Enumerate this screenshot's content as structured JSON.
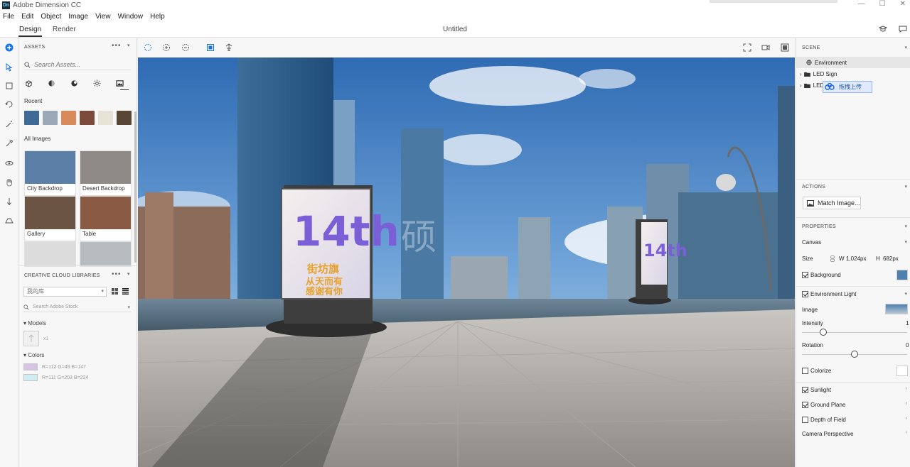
{
  "app": {
    "title": "Adobe Dimension CC",
    "icon_letters": "Dn",
    "window_controls": [
      "—",
      "☐",
      "✕"
    ]
  },
  "menu": [
    "File",
    "Edit",
    "Object",
    "Image",
    "View",
    "Window",
    "Help"
  ],
  "tabs": {
    "design": "Design",
    "render": "Render"
  },
  "document": {
    "title": "Untitled"
  },
  "assets": {
    "header": "ASSETS",
    "search_placeholder": "Search Assets...",
    "category_icons": [
      "model-icon",
      "material-icon",
      "light-icon",
      "sun-icon",
      "image-icon"
    ],
    "recent_label": "Recent",
    "recent_colors": [
      "#3e6a96",
      "#9aa8b8",
      "#d98a5a",
      "#7a4a3a",
      "#e8e3d8",
      "#5a4635"
    ],
    "all_images_label": "All Images",
    "images": [
      {
        "label": "City Backdrop",
        "color": "#5b7fa6"
      },
      {
        "label": "Desert Backdrop",
        "color": "#8f8a85"
      },
      {
        "label": "Gallery",
        "color": "#6b5444"
      },
      {
        "label": "Table",
        "color": "#8a5a44"
      },
      {
        "label": "",
        "color": "#dcdcdc"
      },
      {
        "label": "",
        "color": "#b7bcc1"
      }
    ]
  },
  "libraries": {
    "header": "CREATIVE CLOUD LIBRARIES",
    "selected_library": "我的库",
    "stock_placeholder": "Search Adobe Stock",
    "models_label": "Models",
    "model_count": "x1",
    "colors_label": "Colors",
    "colors": [
      {
        "label": "R=112 G=49 B=147",
        "hex": "#d6c3e6"
      },
      {
        "label": "R=111 G=203 B=224",
        "hex": "#cfeef2"
      }
    ]
  },
  "scene": {
    "header": "SCENE",
    "items": [
      {
        "label": "Environment"
      },
      {
        "label": "LED Sign"
      },
      {
        "label": "LED"
      }
    ],
    "upload_badge": "拖拽上传"
  },
  "actions": {
    "header": "ACTIONS",
    "match_image": "Match Image..."
  },
  "properties": {
    "header": "PROPERTIES",
    "canvas_label": "Canvas",
    "size_label": "Size",
    "width_prefix": "W",
    "width": "1,024px",
    "height_prefix": "H",
    "height": "682px",
    "background_label": "Background",
    "env_light_label": "Environment Light",
    "image_label": "Image",
    "intensity_label": "Intensity",
    "intensity_value": "1",
    "intensity_fraction": 0.2,
    "rotation_label": "Rotation",
    "rotation_value": "0",
    "rotation_fraction": 0.5,
    "colorize_label": "Colorize",
    "sunlight_label": "Sunlight",
    "ground_plane_label": "Ground Plane",
    "dof_label": "Depth of Field",
    "camera_label": "Camera Perspective"
  },
  "viewport": {
    "sign_text": "14th",
    "sign_lines": [
      "街坊旗",
      "从天而有",
      "感谢有你"
    ],
    "watermark": "硕"
  }
}
